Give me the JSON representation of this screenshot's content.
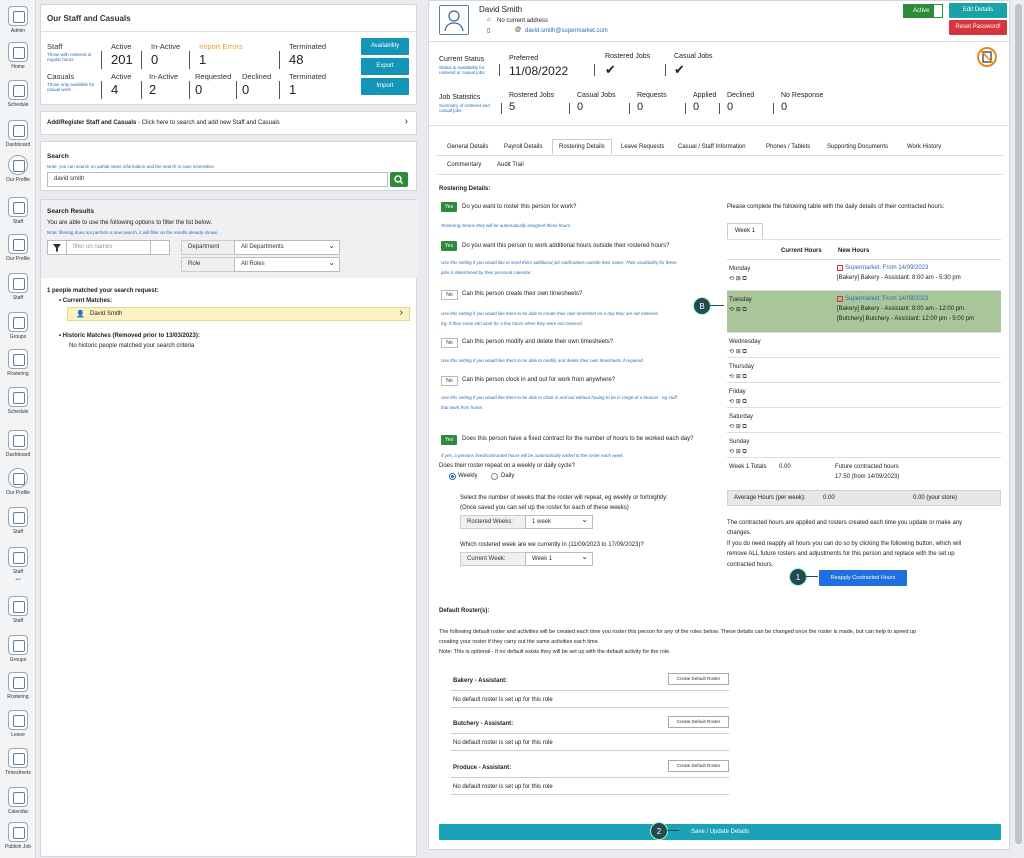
{
  "nav": {
    "items": [
      {
        "label": "Admin",
        "icon": "gear-icon"
      },
      {
        "label": "Home",
        "icon": "home-icon"
      },
      {
        "label": "Schedule",
        "icon": "calendar-icon"
      },
      {
        "label": "Dashboard",
        "icon": "chart-icon"
      },
      {
        "label": "Our Profile",
        "icon": "profile-icon"
      },
      {
        "label": "Staff",
        "icon": "staff-icon"
      },
      {
        "label": "Our Profile",
        "icon": "people-icon"
      },
      {
        "label": "Staff",
        "icon": "staff-icon"
      },
      {
        "label": "Groups",
        "icon": "groups-icon"
      },
      {
        "label": "Rostering",
        "icon": "rostering-icon"
      },
      {
        "label": "Schedule",
        "icon": "calendar-icon"
      },
      {
        "label": "Dashboard",
        "icon": "chart-icon"
      },
      {
        "label": "Our Profile",
        "icon": "profile-icon"
      },
      {
        "label": "Staff",
        "icon": "staff-icon"
      },
      {
        "label": "Staff",
        "icon": "staff-icon"
      },
      {
        "label": "",
        "icon": "more-icon"
      },
      {
        "label": "Staff",
        "icon": "staff-icon"
      },
      {
        "label": "Groups",
        "icon": "groups-icon"
      },
      {
        "label": "Rostering",
        "icon": "rostering-icon"
      },
      {
        "label": "Leave",
        "icon": "leave-icon"
      },
      {
        "label": "Timesheets",
        "icon": "timesheets-icon"
      },
      {
        "label": "Calendar",
        "icon": "calendar-icon"
      },
      {
        "label": "Publish Job",
        "icon": "publish-icon"
      }
    ]
  },
  "staff_panel": {
    "title": "Our Staff and Casuals",
    "staff_label": "Staff",
    "staff_sub": "Those with rostered or regular hours",
    "casuals_label": "Casuals",
    "casuals_sub": "Those only available for casual work",
    "staff_stats": {
      "active_label": "Active",
      "active": "201",
      "inactive_label": "In-Active",
      "inactive": "0",
      "errors_label": "Import Errors",
      "errors": "1",
      "terminated_label": "Terminated",
      "terminated": "48"
    },
    "casual_stats": {
      "active_label": "Active",
      "active": "4",
      "inactive_label": "In-Active",
      "inactive": "2",
      "requested_label": "Requested",
      "requested": "0",
      "declined_label": "Declined",
      "declined": "0",
      "terminated_label": "Terminated",
      "terminated": "1"
    },
    "buttons": {
      "availability": "Availability",
      "export": "Export",
      "import": "Import"
    }
  },
  "add_register": {
    "bold": "Add/Register Staff and Casuals",
    "rest": " - Click here to search and add new Staff and Casuals"
  },
  "search": {
    "title": "Search",
    "note": "Note: you can search on partial name information and the search is case insensitive.",
    "value": "david smith"
  },
  "results": {
    "title": "Search Results",
    "desc": "You are able to use the following options to filter the list below.",
    "note": "Note: filtering does not perform a new search, it will filter on the results already shown.",
    "filter_placeholder": "filter on names",
    "department_label": "Department",
    "department_value": "All Departments",
    "role_label": "Role",
    "role_value": "All Roles",
    "matched": "1 people matched your search request:",
    "current_label": "Current Matches:",
    "current_name": "David Smith",
    "historic_label": "Historic Matches (Removed prior to 13/03/2023):",
    "historic_none": "No historic people matched your search criteria"
  },
  "person": {
    "name": "David Smith",
    "address": "No current address",
    "email": "david.smith@supermarket.com",
    "active_label": "Active",
    "edit_label": "Edit Details",
    "reset_label": "Reset Password!"
  },
  "status": {
    "current_status_label": "Current Status",
    "current_status_sub": "Status & availability for rostered or casual jobs",
    "preferred_label": "Preferred",
    "preferred_value": "11/08/2022",
    "rostered_jobs_label": "Rostered Jobs",
    "casual_jobs_label": "Casual Jobs",
    "job_stats_label": "Job Statistics",
    "job_stats_sub": "Summary of rostered and casual jobs",
    "stats": [
      {
        "label": "Rostered Jobs",
        "value": "5"
      },
      {
        "label": "Casual Jobs",
        "value": "0"
      },
      {
        "label": "Requests",
        "value": "0"
      },
      {
        "label": "Applied",
        "value": "0"
      },
      {
        "label": "Declined",
        "value": "0"
      },
      {
        "label": "No Response",
        "value": "0"
      }
    ]
  },
  "tabs": [
    "General Details",
    "Payroll Details",
    "Rostering Details",
    "Leave Requests",
    "Casual / Staff Information",
    "Phones / Tablets",
    "Supporting Documents",
    "Work History",
    "Commentary",
    "Audit Trail"
  ],
  "rostering": {
    "title": "Rostering Details:",
    "yes": "Yes",
    "no": "No",
    "q1": "Do you want to roster this person for work?",
    "h1": "Rostering means they will be automatically assigned these hours.",
    "q2": "Do you want this person to work additional hours outside their rostered hours?",
    "h2a": "Use this setting if you would like to send them additional job notifications outside their roster. Their availability for these",
    "h2b": "jobs is determined by their personal calendar.",
    "q3": "Can this person create their own timesheets?",
    "h3a": "Use this setting if you would like them to be able to create their own timesheet on a day they are not rostered.",
    "h3b": "Eg. if they come into work for a few hours when they were not rostered.",
    "q4": "Can this person modify and delete their own timesheets?",
    "h4": "Use this setting if you would like them to be able to modify and delete their own timesheets if required.",
    "q5": "Can this person clock in and out for work from anywhere?",
    "h5a": "Use this setting if you would like them to be able to clock in and out without having to be in range of a beacon - eg staff",
    "h5b": "that work from home.",
    "q6": "Does this person have a fixed contract for the number of hours to be worked each day?",
    "h6": "If yes, a persons fixed/contracted hours will be automatically added to the roster each week.",
    "q7": "Does their roster repeat on a weekly or daily cycle?",
    "weekly": "Weekly",
    "daily": "Daily",
    "weeks_q1": "Select the number of weeks that the roster will repeat, eg weekly or fortnightly:",
    "weeks_q2": "(Once saved you can set up the roster for each of these weeks)",
    "rostered_weeks_label": "Rostered Weeks:",
    "rostered_weeks_value": "1 week",
    "current_week_q": "Which rostered week are we currently in (11/09/2023 to 17/09/2023)?",
    "current_week_label": "Current Week:",
    "current_week_value": "Week 1"
  },
  "hours": {
    "intro": "Please complete the following table with the daily details of their contracted hours:",
    "week_tab": "Week 1",
    "current_hours": "Current Hours",
    "new_hours": "New Hours",
    "days": [
      {
        "day": "Monday",
        "lines": [
          "Supermarket: From 14/09/2023",
          "[Bakery] Bakery - Assistant: 8:00 am - 5:30 pm"
        ]
      },
      {
        "day": "Tuesday",
        "lines": [
          "Supermarket: From 14/09/2023",
          "[Bakery] Bakery - Assistant: 8:00 am - 12:00 pm",
          "[Butchery] Butchery - Assistant: 12:00 pm - 5:00 pm"
        ]
      },
      {
        "day": "Wednesday",
        "lines": []
      },
      {
        "day": "Thursday",
        "lines": []
      },
      {
        "day": "Friday",
        "lines": []
      },
      {
        "day": "Saturday",
        "lines": []
      },
      {
        "day": "Sunday",
        "lines": []
      }
    ],
    "totals_label": "Week 1 Totals",
    "totals_value": "0.00",
    "future_label": "Future contracted hours",
    "future_value": "17.50 (from 14/09/2023)",
    "avg_label": "Average Hours (per week):",
    "avg_value": "0.00",
    "avg_store": "0.00 (your store)",
    "note1": "The contracted hours are applied and rosters created each time you update or make any",
    "note1b": "changes.",
    "note2": "If you do need reapply all hours you can do so by clicking the following button, which will",
    "note2b": "remove ALL future rosters and adjustments for this person and replace with the set up",
    "note2c": "contracted hours.",
    "reapply": "Reapply Contracted Hours"
  },
  "default_roster": {
    "title": "Default Roster(s):",
    "desc1": "The following default roster and activities will be created each time you roster this person for any of the roles below. These details can be changed once the roster is made, but can help to speed up",
    "desc2": "creating your roster if they carry out the same activities each time.",
    "desc3": "Note: This is optional - if no default exists they will be set up with the default activity for the role.",
    "roles": [
      {
        "name": "Bakery - Assistant:",
        "none": "No default roster is set up for this role",
        "btn": "Create Default Roster"
      },
      {
        "name": "Butchery - Assistant:",
        "none": "No default roster is set up for this role",
        "btn": "Create Default Roster"
      },
      {
        "name": "Produce - Assistant:",
        "none": "No default roster is set up for this role",
        "btn": "Create Default Roster"
      }
    ]
  },
  "save": "Save / Update Details",
  "callouts": {
    "one": "1",
    "two": "2",
    "b": "B"
  },
  "colors": {
    "teal": "#1295b8",
    "green": "#2e8b3a",
    "red": "#d9333f",
    "highlight": "#a9c59a",
    "callout": "#234a52"
  }
}
